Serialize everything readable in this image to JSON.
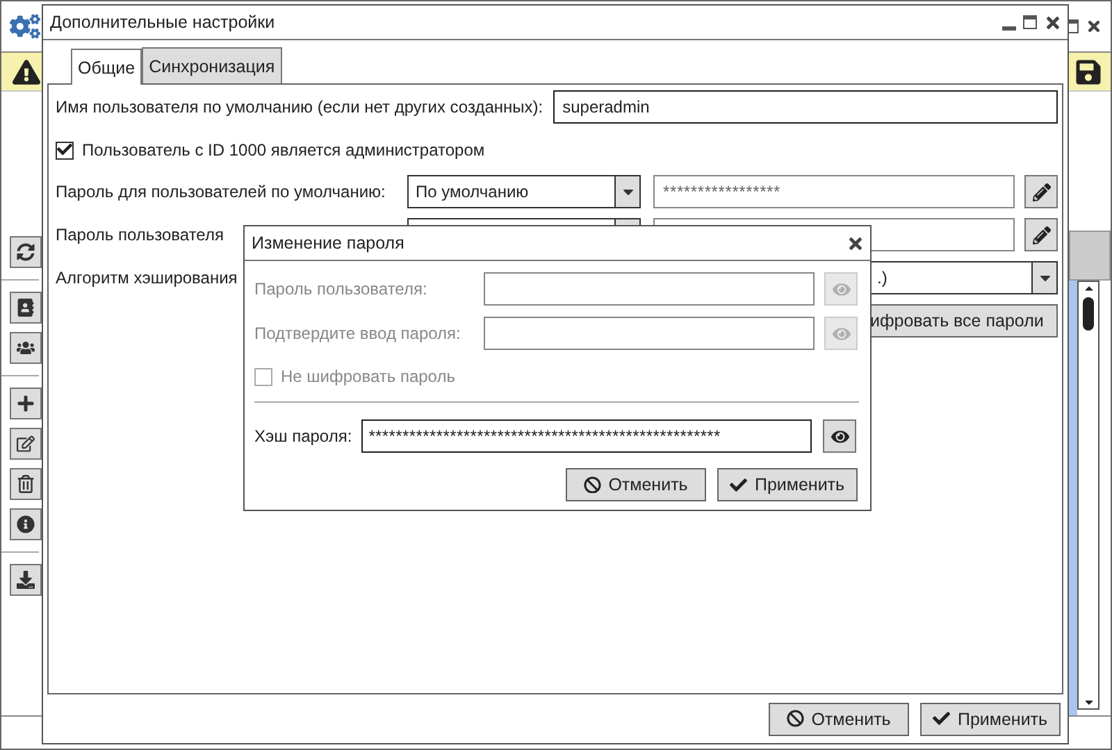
{
  "settings_dialog": {
    "title": "Дополнительные настройки",
    "tabs": [
      {
        "label": "Общие",
        "selected": true
      },
      {
        "label": "Синхронизация",
        "selected": false
      }
    ],
    "default_user": {
      "label": "Имя пользователя по умолчанию (если нет других созданных):",
      "value": "superadmin"
    },
    "admin_checkbox": {
      "label": "Пользователь с ID 1000 является администратором",
      "checked": true
    },
    "default_password": {
      "label": "Пароль для пользователей по умолчанию:",
      "mode": "По умолчанию",
      "value": "*****************"
    },
    "user_password": {
      "label": "Пароль пользователя"
    },
    "hash_algorithm": {
      "label": "Алгоритм хэширования",
      "value": ".)"
    },
    "encrypt_button": "ифровать все пароли",
    "buttons": [
      {
        "label": "Отменить",
        "kind": "cancel"
      },
      {
        "label": "Применить",
        "kind": "apply"
      }
    ]
  },
  "password_dialog": {
    "title": "Изменение пароля",
    "fields": [
      {
        "label": "Пароль пользователя:",
        "disabled": true
      },
      {
        "label": "Подтвердите ввод пароля:",
        "disabled": true
      }
    ],
    "no_encrypt": {
      "label": "Не шифровать пароль",
      "checked": false,
      "disabled": true
    },
    "hash": {
      "label": "Хэш пароля:",
      "value": "****************************************************"
    },
    "buttons": [
      {
        "label": "Отменить",
        "kind": "cancel"
      },
      {
        "label": "Применить",
        "kind": "apply"
      }
    ]
  }
}
